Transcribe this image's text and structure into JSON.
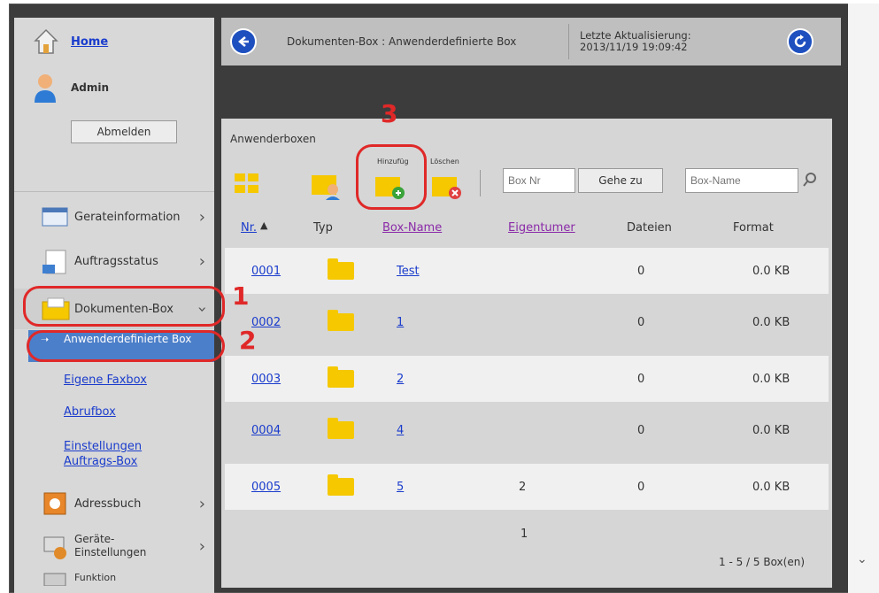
{
  "sidebar": {
    "home_label": "Home",
    "user_label": "Admin",
    "logout_label": "Abmelden",
    "items": [
      {
        "label": "Gerateinformation"
      },
      {
        "label": "Auftragsstatus"
      },
      {
        "label": "Dokumenten-Box"
      },
      {
        "label": "Adressbuch"
      },
      {
        "label": "Geräte-\nEinstellungen"
      },
      {
        "label": "Funktion"
      }
    ],
    "sub_items": [
      {
        "label": "Anwenderdefinierte Box"
      },
      {
        "label": "Eigene Faxbox"
      },
      {
        "label": "Abrufbox"
      },
      {
        "label": "Einstellungen Auftrags-Box"
      }
    ]
  },
  "header": {
    "breadcrumb": "Dokumenten-Box : Anwenderdefinierte Box",
    "last_update_label": "Letzte Aktualisierung:",
    "last_update_value": "2013/11/19 19:09:42"
  },
  "content": {
    "section_title": "Anwenderboxen",
    "toolbar": {
      "add_label": "Hinzufüg",
      "delete_label": "Löschen",
      "box_nr_placeholder": "Box Nr",
      "goto_label": "Gehe zu",
      "box_name_placeholder": "Box-Name"
    },
    "columns": [
      "Nr.",
      "Typ",
      "Box-Name",
      "Eigentumer",
      "Dateien",
      "Format"
    ],
    "rows": [
      {
        "nr": "0001",
        "name": "Test",
        "owner": "",
        "files": "0",
        "size": "0.0 KB"
      },
      {
        "nr": "0002",
        "name": "1",
        "owner": "",
        "files": "0",
        "size": "0.0 KB"
      },
      {
        "nr": "0003",
        "name": "2",
        "owner": "",
        "files": "0",
        "size": "0.0 KB"
      },
      {
        "nr": "0004",
        "name": "4",
        "owner": "",
        "files": "0",
        "size": "0.0 KB"
      },
      {
        "nr": "0005",
        "name": "5",
        "owner": "2",
        "files": "0",
        "size": "0.0 KB"
      }
    ],
    "page_number": "1",
    "range_label": "1 - 5 / 5 Box(en)"
  },
  "annotations": [
    "1",
    "2",
    "3"
  ],
  "colors": {
    "accent": "#1d4fbf",
    "highlight": "#e02828",
    "folder": "#f5c800"
  }
}
